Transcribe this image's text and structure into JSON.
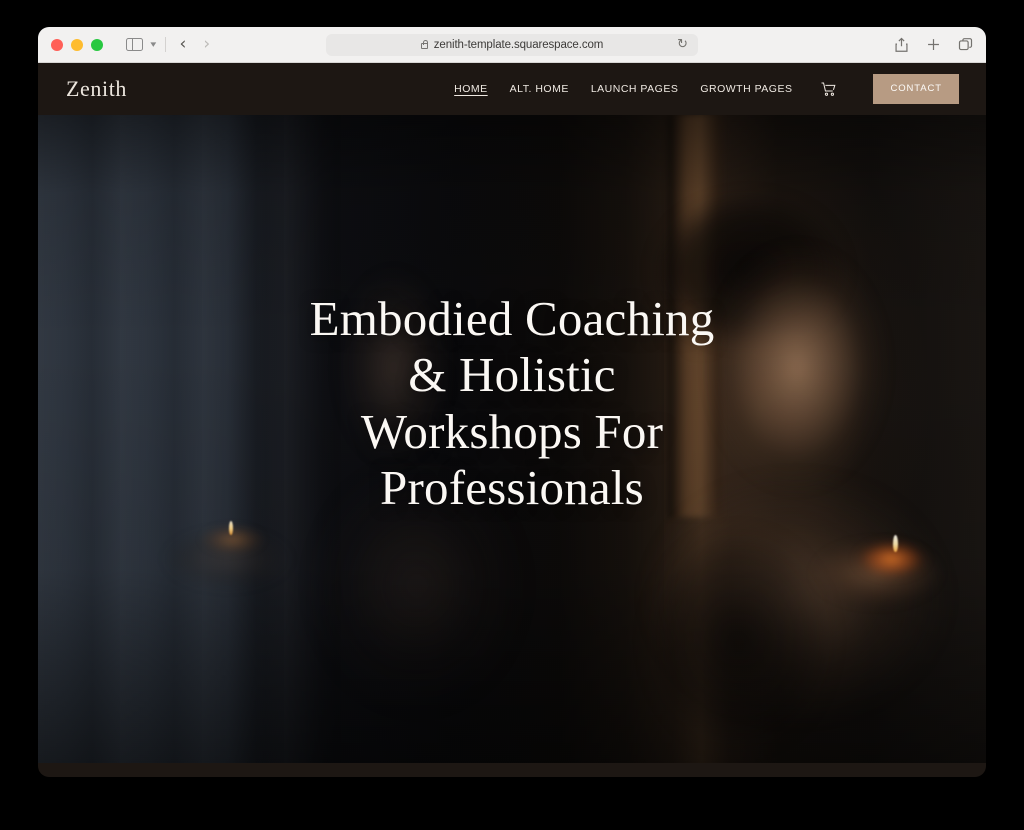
{
  "browser": {
    "traffic_lights": [
      "close",
      "minimize",
      "maximize"
    ],
    "sidebar_toggle_icon": "sidebar-icon",
    "tab_group_chevron_icon": "chevron-down-icon",
    "back_icon": "chevron-left-icon",
    "forward_icon": "chevron-right-icon",
    "url": "zenith-template.squarespace.com",
    "lock_icon": "lock-icon",
    "reload_icon": "reload-icon",
    "share_icon": "share-icon",
    "new_tab_icon": "plus-icon",
    "tab_overview_icon": "tabs-icon"
  },
  "site": {
    "brand": "Zenith",
    "nav": [
      {
        "label": "HOME",
        "active": true
      },
      {
        "label": "ALT. HOME",
        "active": false
      },
      {
        "label": "LAUNCH PAGES",
        "active": false
      },
      {
        "label": "GROWTH PAGES",
        "active": false
      }
    ],
    "cart_icon": "shopping-cart-icon",
    "contact_label": "CONTACT",
    "hero": {
      "line1": "Embodied Coaching",
      "line2": "& Holistic",
      "line3": "Workshops For",
      "line4": "Professionals"
    }
  },
  "colors": {
    "header_bg": "#1d1713",
    "accent_button": "#b79b83",
    "text_cream": "#efe9e2",
    "hero_title": "#fbf8f4",
    "page_bg": "#000000",
    "toolbar_bg": "#f2f1f0"
  }
}
